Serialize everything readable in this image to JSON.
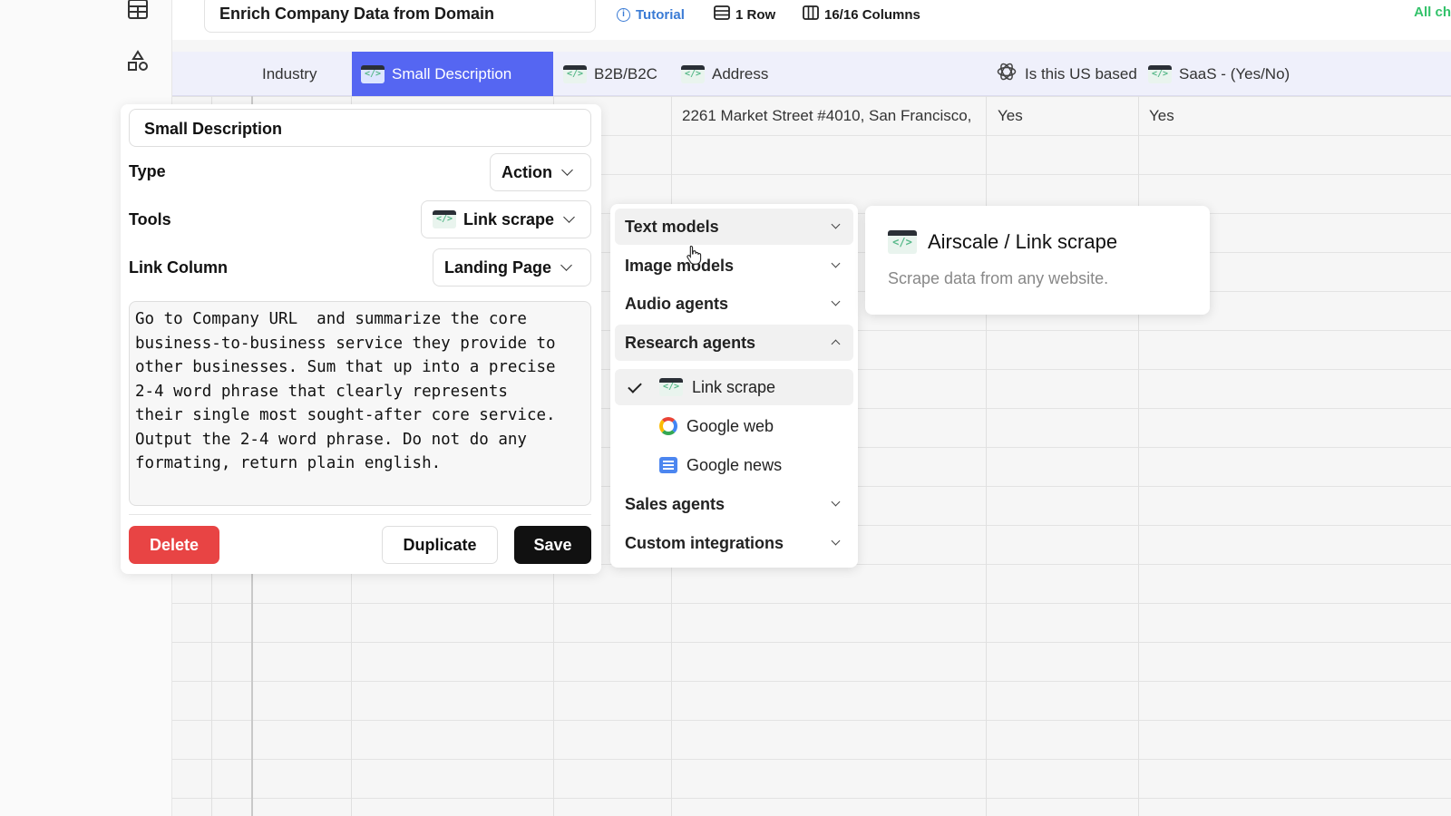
{
  "topbar": {
    "sheet_title": "Enrich Company Data from Domain",
    "tutorial_label": "Tutorial",
    "rows_label": "1 Row",
    "columns_label": "16/16 Columns",
    "right_label": "All ch"
  },
  "columns": [
    {
      "label": "Industry"
    },
    {
      "label": "Small Description"
    },
    {
      "label": "B2B/B2C"
    },
    {
      "label": "Address"
    },
    {
      "label": "Is this US based"
    },
    {
      "label": "SaaS - (Yes/No)"
    }
  ],
  "row1": {
    "address": "2261 Market Street #4010, San Francisco,",
    "us_based": "Yes",
    "saas": "Yes"
  },
  "panel": {
    "name_value": "Small Description",
    "type_label": "Type",
    "type_value": "Action",
    "tools_label": "Tools",
    "tools_value": "Link scrape",
    "link_column_label": "Link Column",
    "link_column_value": "Landing Page",
    "prompt_text": "Go to Company URL  and summarize the core\nbusiness-to-business service they provide to\nother businesses. Sum that up into a precise\n2-4 word phrase that clearly represents\ntheir single most sought-after core service.\nOutput the 2-4 word phrase. Do not do any\nformating, return plain english.",
    "delete_label": "Delete",
    "duplicate_label": "Duplicate",
    "save_label": "Save"
  },
  "dropdown": {
    "groups": [
      {
        "label": "Text models"
      },
      {
        "label": "Image models"
      },
      {
        "label": "Audio agents"
      },
      {
        "label": "Research agents"
      },
      {
        "label": "Sales agents"
      },
      {
        "label": "Custom integrations"
      }
    ],
    "research_items": [
      {
        "label": "Link scrape",
        "selected": true,
        "icon": "code-icon"
      },
      {
        "label": "Google web",
        "selected": false,
        "icon": "google-icon"
      },
      {
        "label": "Google news",
        "selected": false,
        "icon": "google-news-icon"
      }
    ]
  },
  "card": {
    "title": "Airscale / Link scrape",
    "description": "Scrape data from any website."
  },
  "colors": {
    "accent": "#5566f2",
    "delete": "#e84444",
    "save": "#111111",
    "tutorial": "#3a7bd5"
  }
}
